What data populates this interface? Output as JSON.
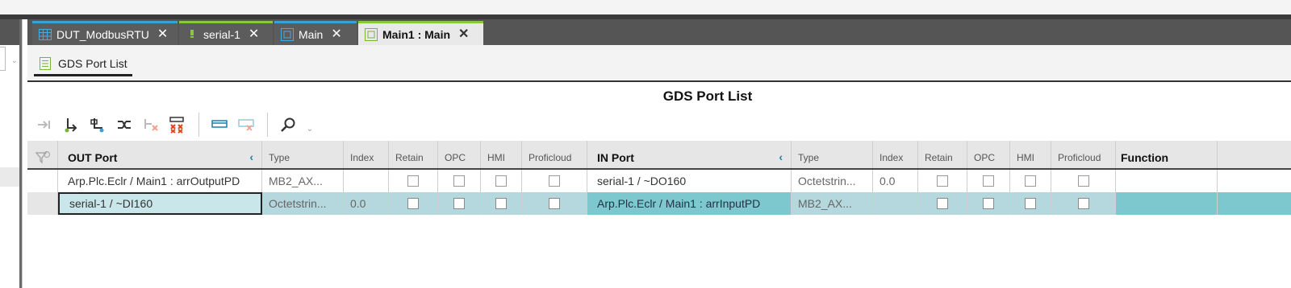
{
  "tabs": [
    {
      "label": "DUT_ModbusRTU",
      "icon": "table-icon"
    },
    {
      "label": "serial-1",
      "icon": "device-icon"
    },
    {
      "label": "Main",
      "icon": "program-icon"
    },
    {
      "label": "Main1 : Main",
      "icon": "instance-icon"
    }
  ],
  "close_glyph": "✕",
  "subtab": {
    "label": "GDS Port List",
    "icon": "list-icon"
  },
  "page_title": "GDS Port List",
  "toolbar": [
    "connect-icon",
    "add-out-port-icon",
    "add-in-port-icon",
    "swap-icon",
    "remove-icon",
    "delete-all-icon",
    "group-icon",
    "ungroup-icon",
    "search-icon"
  ],
  "columns": {
    "out_port": "OUT Port",
    "type": "Type",
    "index": "Index",
    "retain": "Retain",
    "opc": "OPC",
    "hmi": "HMI",
    "proficloud": "Proficloud",
    "in_port": "IN Port",
    "function": "Function",
    "collapse_glyph": "‹"
  },
  "rows": [
    {
      "out_port": "Arp.Plc.Eclr / Main1 : arrOutputPD",
      "out_type": "MB2_AX...",
      "out_index": "",
      "in_port": "serial-1 / ~DO160",
      "in_type": "Octetstrin...",
      "in_index": "0.0"
    },
    {
      "out_port": "serial-1 / ~DI160",
      "out_type": "Octetstrin...",
      "out_index": "0.0",
      "in_port": "Arp.Plc.Eclr / Main1 : arrInputPD",
      "in_type": "MB2_AX...",
      "in_index": ""
    }
  ],
  "colors": {
    "accent_green": "#8cc63f",
    "accent_blue": "#3aa0d8",
    "selection": "#7cc8ce"
  }
}
